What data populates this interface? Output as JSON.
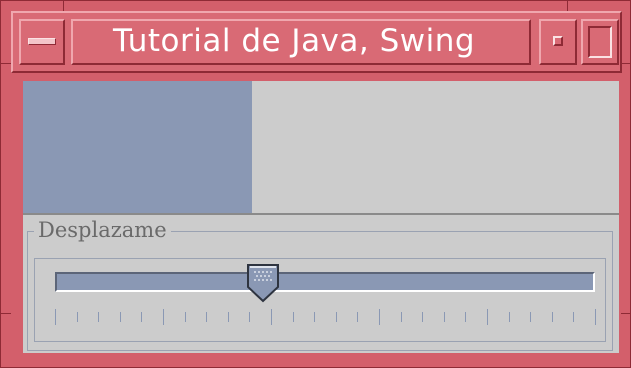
{
  "window": {
    "title": "Tutorial de Java, Swing"
  },
  "colors": {
    "frame": "#d35f6b",
    "title_text": "#ffffff",
    "panel_background": "#cccccc",
    "slider_fill": "#8a98b4"
  },
  "icons": {
    "menu": "window-menu-icon",
    "minimize": "minimize-icon",
    "maximize": "maximize-icon"
  },
  "slider": {
    "group_label": "Desplazame",
    "value_fraction": 0.385,
    "major_tick_every": 5,
    "tick_count": 26
  }
}
